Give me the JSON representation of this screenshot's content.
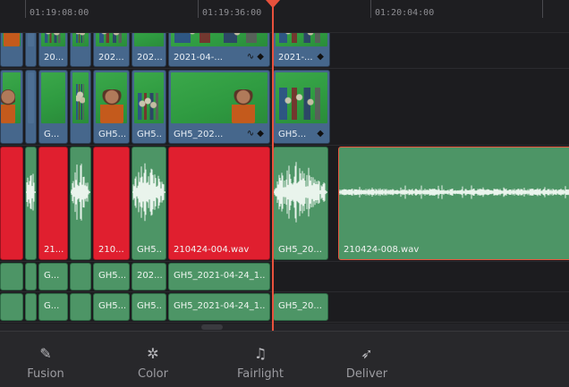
{
  "ruler": {
    "timecodes": [
      "01:19:08:00",
      "01:19:36:00",
      "01:20:04:00"
    ]
  },
  "tracks": {
    "video_top": {
      "clips": [
        {
          "label": "",
          "kind": "fig"
        },
        {
          "label": "",
          "kind": "blank"
        },
        {
          "label": "20...",
          "kind": "kids"
        },
        {
          "label": "",
          "kind": "kids"
        },
        {
          "label": "202...",
          "kind": "kids"
        },
        {
          "label": "202...",
          "kind": "blank"
        },
        {
          "label": "2021-04-...",
          "kind": "kids"
        },
        {
          "label": "2021-...",
          "kind": "kids"
        }
      ]
    },
    "video_main": {
      "clips": [
        {
          "label": "",
          "kind": "fig"
        },
        {
          "label": "",
          "kind": "blank"
        },
        {
          "label": "G...",
          "kind": "blank"
        },
        {
          "label": "",
          "kind": "kids"
        },
        {
          "label": "GH5...",
          "kind": "fig"
        },
        {
          "label": "GH5...",
          "kind": "kids"
        },
        {
          "label": "GH5_202...",
          "kind": "fig"
        },
        {
          "label": "GH5...",
          "kind": "kids"
        }
      ]
    },
    "audio_main": {
      "clips": [
        {
          "label": "",
          "color": "red"
        },
        {
          "label": "",
          "color": "green"
        },
        {
          "label": "21...",
          "color": "red"
        },
        {
          "label": "",
          "color": "green"
        },
        {
          "label": "210...",
          "color": "red"
        },
        {
          "label": "GH5...",
          "color": "green"
        },
        {
          "label": "210424-004.wav",
          "color": "red"
        },
        {
          "label": "GH5_20...",
          "color": "green"
        },
        {
          "label": "210424-008.wav",
          "color": "green",
          "selected": true
        }
      ]
    },
    "audio_a2": {
      "clips": [
        "",
        "G...",
        "",
        "GH5...",
        "202...",
        "GH5_2021-04-24_1..."
      ]
    },
    "audio_a3": {
      "clips": [
        "",
        "G...",
        "",
        "GH5...",
        "GH5...",
        "GH5_2021-04-24_1...",
        "GH5_20..."
      ]
    }
  },
  "pages": [
    {
      "label": "Fusion",
      "icon": "fusion-icon",
      "glyph": "✎"
    },
    {
      "label": "Color",
      "icon": "color-icon",
      "glyph": "✲"
    },
    {
      "label": "Fairlight",
      "icon": "fairlight-icon",
      "glyph": "♫"
    },
    {
      "label": "Deliver",
      "icon": "deliver-icon",
      "glyph": "➶"
    }
  ],
  "colors": {
    "playhead": "#e8513c",
    "video_clip": "#46678c",
    "audio_clip": "#4d9566",
    "audio_flagged": "#e01f2f",
    "selection_outline": "#e9573f"
  }
}
